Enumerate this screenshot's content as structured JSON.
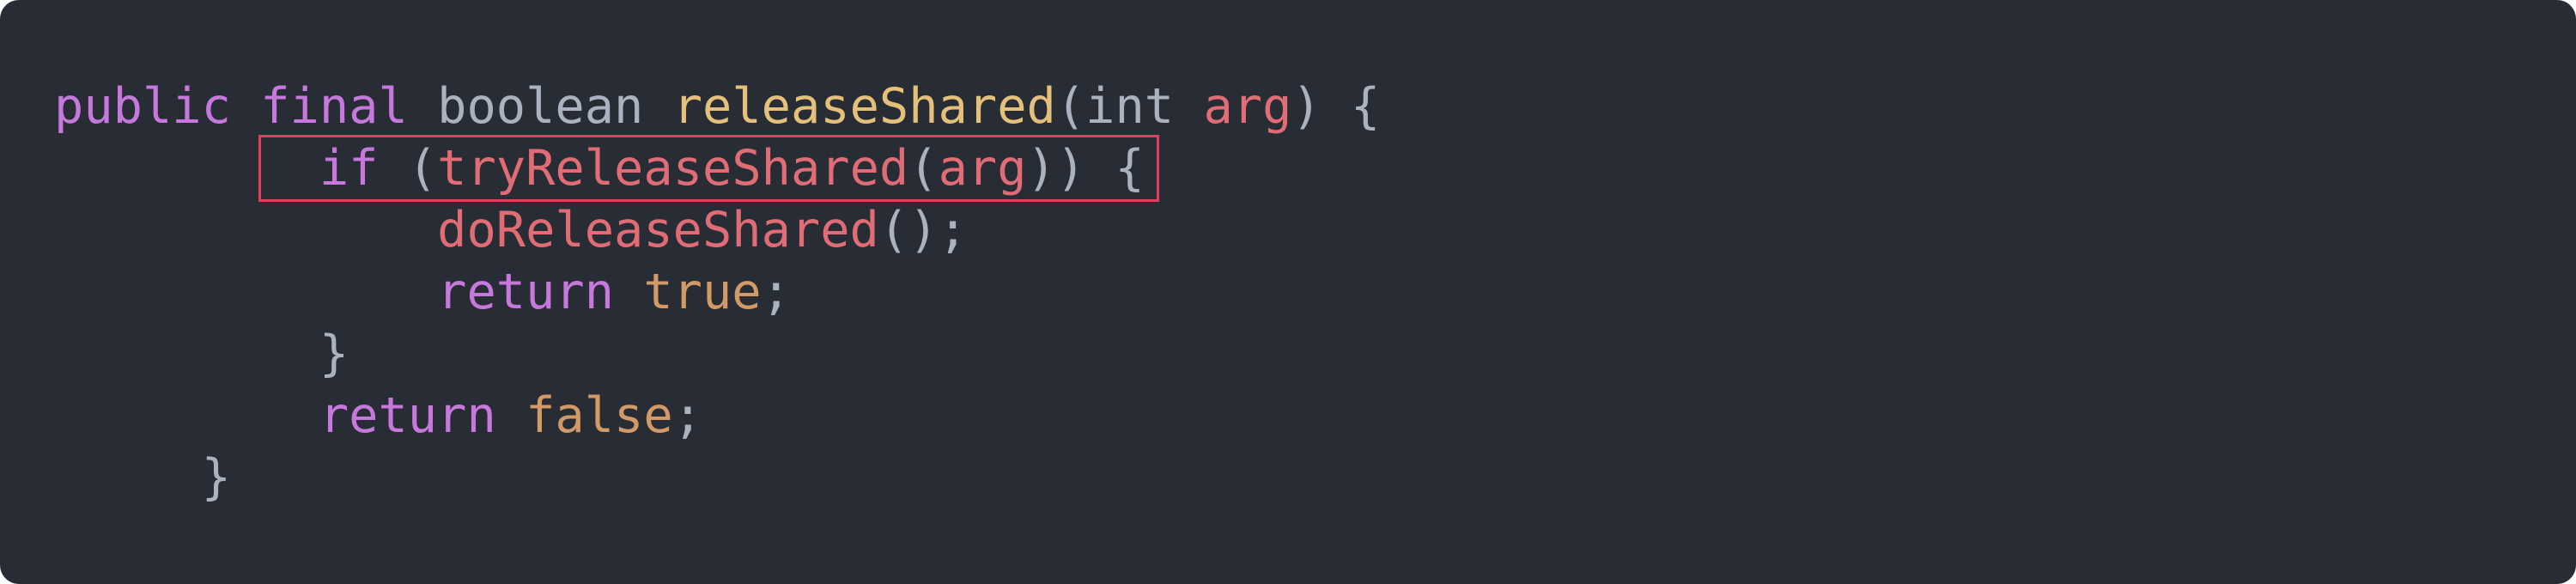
{
  "colors": {
    "background": "#282c34",
    "keyword": "#c678dd",
    "type": "#abb2bf",
    "function_def": "#e5c07b",
    "parameter": "#e06c75",
    "function_call": "#e06c75",
    "literal": "#d19a66",
    "punctuation": "#abb2bf",
    "highlight_border": "#e0405e"
  },
  "code": {
    "lines": [
      {
        "indent": "",
        "tokens": [
          "public",
          " ",
          "final",
          " ",
          "boolean",
          " ",
          "releaseShared",
          "(",
          "int",
          " ",
          "arg",
          ")",
          " ",
          "{"
        ]
      },
      {
        "indent": "         ",
        "tokens": [
          "if",
          " ",
          "(",
          "tryReleaseShared",
          "(",
          "arg",
          "))",
          " ",
          "{"
        ]
      },
      {
        "indent": "             ",
        "tokens": [
          "doReleaseShared",
          "();"
        ]
      },
      {
        "indent": "             ",
        "tokens": [
          "return",
          " ",
          "true",
          ";"
        ]
      },
      {
        "indent": "         ",
        "tokens": [
          "}"
        ]
      },
      {
        "indent": "         ",
        "tokens": [
          "return",
          " ",
          "false",
          ";"
        ]
      },
      {
        "indent": "     ",
        "tokens": [
          "}"
        ]
      }
    ]
  }
}
